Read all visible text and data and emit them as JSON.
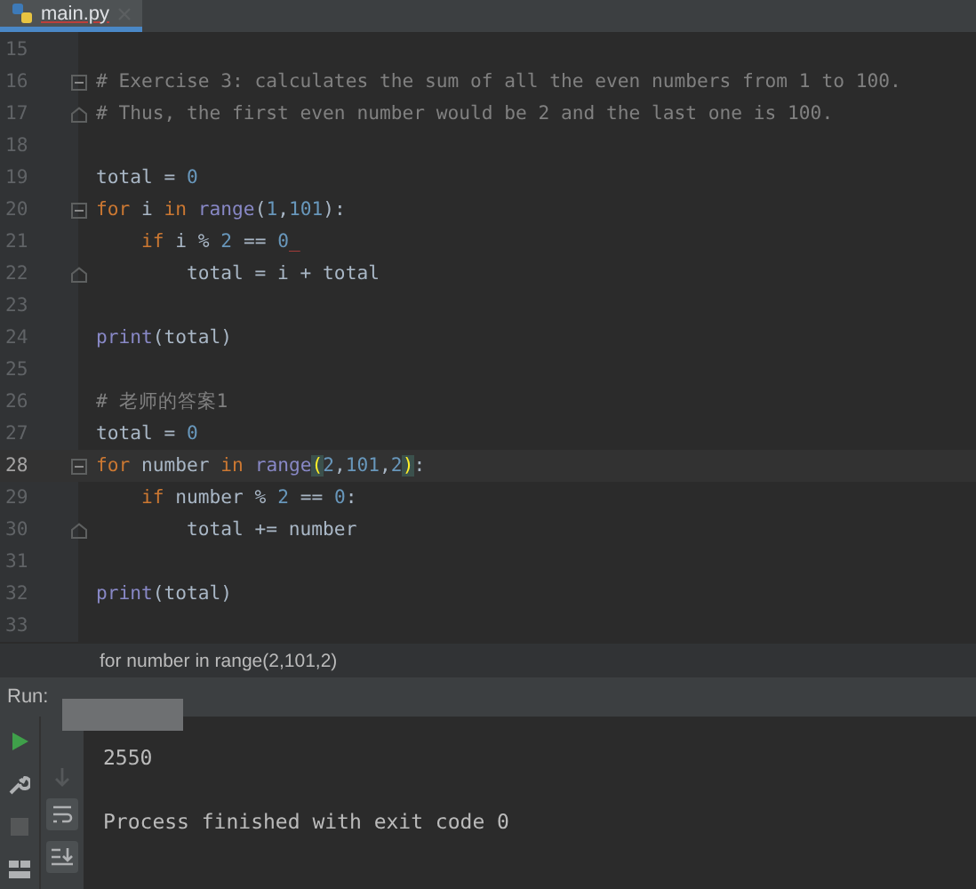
{
  "tabs": [
    {
      "label": "main.py",
      "selected": true
    }
  ],
  "editor": {
    "lines": [
      {
        "number": "15",
        "current": false
      },
      {
        "number": "16",
        "current": false,
        "fold_start": true,
        "tokens": [
          {
            "kind": "comment",
            "text": "# Exercise 3: calculates the sum of all the even numbers from 1 to 100."
          }
        ]
      },
      {
        "number": "17",
        "current": false,
        "fold_end": true,
        "tokens": [
          {
            "kind": "comment",
            "text": "# Thus, the first even number would be 2 and the last one is 100."
          }
        ]
      },
      {
        "number": "18",
        "current": false
      },
      {
        "number": "19",
        "current": false,
        "tokens": [
          {
            "kind": "plain",
            "text": "total = "
          },
          {
            "kind": "number",
            "text": "0"
          }
        ]
      },
      {
        "number": "20",
        "current": false,
        "fold_start": true,
        "tokens": [
          {
            "kind": "keyword",
            "text": "for"
          },
          {
            "kind": "plain",
            "text": " i "
          },
          {
            "kind": "keyword",
            "text": "in"
          },
          {
            "kind": "builtin",
            "text": " range"
          },
          {
            "kind": "plain",
            "text": "("
          },
          {
            "kind": "number",
            "text": "1"
          },
          {
            "kind": "plain",
            "text": ","
          },
          {
            "kind": "number",
            "text": "101"
          },
          {
            "kind": "plain",
            "text": "):"
          }
        ]
      },
      {
        "number": "21",
        "current": false,
        "tokens": [
          {
            "kind": "keyword",
            "text": "    if"
          },
          {
            "kind": "plain",
            "text": " i % "
          },
          {
            "kind": "number",
            "text": "2"
          },
          {
            "kind": "plain",
            "text": " == "
          },
          {
            "kind": "number",
            "text": "0"
          },
          {
            "kind": "error",
            "text": "_"
          }
        ]
      },
      {
        "number": "22",
        "current": false,
        "fold_end": true,
        "tokens": [
          {
            "kind": "plain",
            "text": "        total = i + total"
          }
        ]
      },
      {
        "number": "23",
        "current": false
      },
      {
        "number": "24",
        "current": false,
        "tokens": [
          {
            "kind": "builtin",
            "text": "print"
          },
          {
            "kind": "plain",
            "text": "(total)"
          }
        ]
      },
      {
        "number": "25",
        "current": false
      },
      {
        "number": "26",
        "current": false,
        "tokens": [
          {
            "kind": "comment",
            "text": "# 老师的答案1"
          }
        ]
      },
      {
        "number": "27",
        "current": false,
        "tokens": [
          {
            "kind": "plain",
            "text": "total = "
          },
          {
            "kind": "number",
            "text": "0"
          }
        ]
      },
      {
        "number": "28",
        "current": true,
        "fold_start": true,
        "tokens": [
          {
            "kind": "keyword",
            "text": "for"
          },
          {
            "kind": "plain",
            "text": " number "
          },
          {
            "kind": "keyword",
            "text": "in"
          },
          {
            "kind": "builtin",
            "text": " range"
          },
          {
            "kind": "bracket",
            "text": "("
          },
          {
            "kind": "number",
            "text": "2"
          },
          {
            "kind": "plain",
            "text": ","
          },
          {
            "kind": "number",
            "text": "101"
          },
          {
            "kind": "plain",
            "text": ","
          },
          {
            "kind": "number",
            "text": "2"
          },
          {
            "kind": "bracket",
            "text": ")"
          },
          {
            "kind": "plain",
            "text": ":"
          }
        ]
      },
      {
        "number": "29",
        "current": false,
        "tokens": [
          {
            "kind": "keyword",
            "text": "    if"
          },
          {
            "kind": "plain",
            "text": " number % "
          },
          {
            "kind": "number",
            "text": "2"
          },
          {
            "kind": "plain",
            "text": " == "
          },
          {
            "kind": "number",
            "text": "0"
          },
          {
            "kind": "plain",
            "text": ":"
          }
        ]
      },
      {
        "number": "30",
        "current": false,
        "fold_end": true,
        "tokens": [
          {
            "kind": "plain",
            "text": "        total += number"
          }
        ]
      },
      {
        "number": "31",
        "current": false
      },
      {
        "number": "32",
        "current": false,
        "tokens": [
          {
            "kind": "builtin",
            "text": "print"
          },
          {
            "kind": "plain",
            "text": "(total)"
          }
        ]
      },
      {
        "number": "33",
        "current": false
      }
    ]
  },
  "breadcrumb": "for number in range(2,101,2)",
  "run_panel": {
    "label": "Run:",
    "program_output": "2550",
    "exit_message": "Process finished with exit code 0"
  }
}
